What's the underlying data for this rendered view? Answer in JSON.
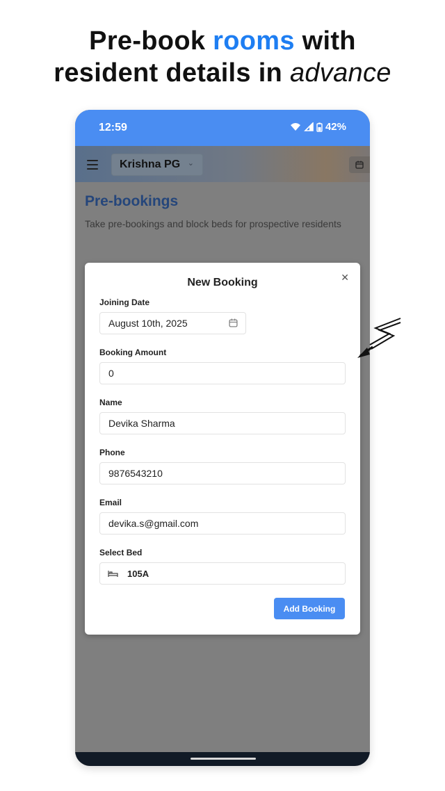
{
  "headline": {
    "part1": "Pre-book ",
    "accent": "rooms",
    "part2": " with",
    "line2": "resident details in ",
    "italic": "advance",
    "accent_color": "#1e7ef2"
  },
  "status_bar": {
    "time": "12:59",
    "battery": "42%",
    "color": "#4a8df2"
  },
  "app_bar": {
    "property_name": "Krishna PG",
    "menu_icon": "hamburger-icon",
    "calendar_icon": "calendar-icon"
  },
  "page": {
    "title": "Pre-bookings",
    "subtitle": "Take pre-bookings and block beds for prospective residents"
  },
  "dialog": {
    "title": "New Booking",
    "close_icon": "close-icon",
    "fields": {
      "joining_date": {
        "label": "Joining Date",
        "value": "August 10th, 2025"
      },
      "booking_amount": {
        "label": "Booking Amount",
        "value": "0"
      },
      "name": {
        "label": "Name",
        "value": "Devika Sharma"
      },
      "phone": {
        "label": "Phone",
        "value": "9876543210"
      },
      "email": {
        "label": "Email",
        "value": "devika.s@gmail.com"
      },
      "select_bed": {
        "label": "Select Bed",
        "value": "105A",
        "icon": "bed-icon"
      }
    },
    "submit_label": "Add Booking",
    "submit_color": "#4a8df2"
  }
}
